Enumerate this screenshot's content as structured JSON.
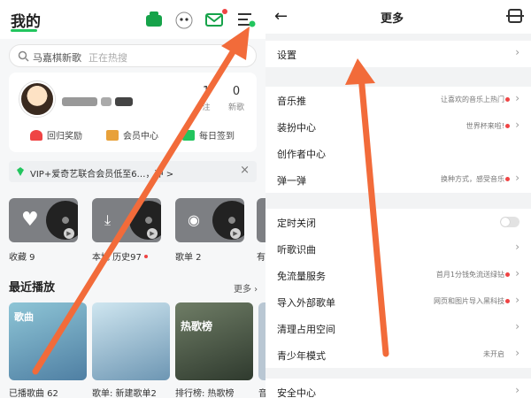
{
  "left": {
    "title": "我的",
    "search": {
      "placeholder": "马嘉棋新歌",
      "hint": "正在热搜"
    },
    "stats": [
      {
        "value": "1",
        "label": "注"
      },
      {
        "value": "0",
        "label": "新歌"
      }
    ],
    "quick": [
      {
        "label": "回归奖励"
      },
      {
        "label": "会员中心"
      },
      {
        "label": "每日签到"
      }
    ],
    "vip_banner": "VIP+爱奇艺联合会员低至6…，冲 >",
    "tiles": [
      {
        "label": "收藏 9"
      },
      {
        "label": "本地 历史97"
      },
      {
        "label": "歌单 2"
      },
      {
        "label": "有"
      }
    ],
    "recent_title": "最近播放",
    "more_label": "更多",
    "recent": [
      {
        "title": "歌曲",
        "label": "已播歌曲 62"
      },
      {
        "title": "",
        "label": "歌单: 新建歌单2"
      },
      {
        "title": "热歌榜",
        "label": "排行榜: 热歌榜"
      },
      {
        "title": "",
        "label": "音"
      }
    ]
  },
  "right": {
    "title": "更多",
    "items": [
      {
        "label": "设置",
        "value": ""
      },
      {
        "label": "音乐推",
        "value": "让喜欢的音乐上热门",
        "dot": true
      },
      {
        "label": "装扮中心",
        "value": "世界杯来啦!",
        "dot": true
      },
      {
        "label": "创作者中心",
        "value": ""
      },
      {
        "label": "弹一弹",
        "value": "换种方式，感受音乐",
        "dot": true
      },
      {
        "label": "定时关闭",
        "value": ""
      },
      {
        "label": "听歌识曲",
        "value": ""
      },
      {
        "label": "免流量服务",
        "value": "首月1分钱免流送绿钻",
        "dot": true
      },
      {
        "label": "导入外部歌单",
        "value": "网页和图片导入黑科技",
        "dot": true
      },
      {
        "label": "清理占用空间",
        "value": ""
      },
      {
        "label": "青少年模式",
        "value": "未开启"
      },
      {
        "label": "安全中心",
        "value": ""
      }
    ]
  },
  "colors": {
    "accent": "#22c55e",
    "arrow": "#f26b3a",
    "dot": "#ef4444"
  }
}
